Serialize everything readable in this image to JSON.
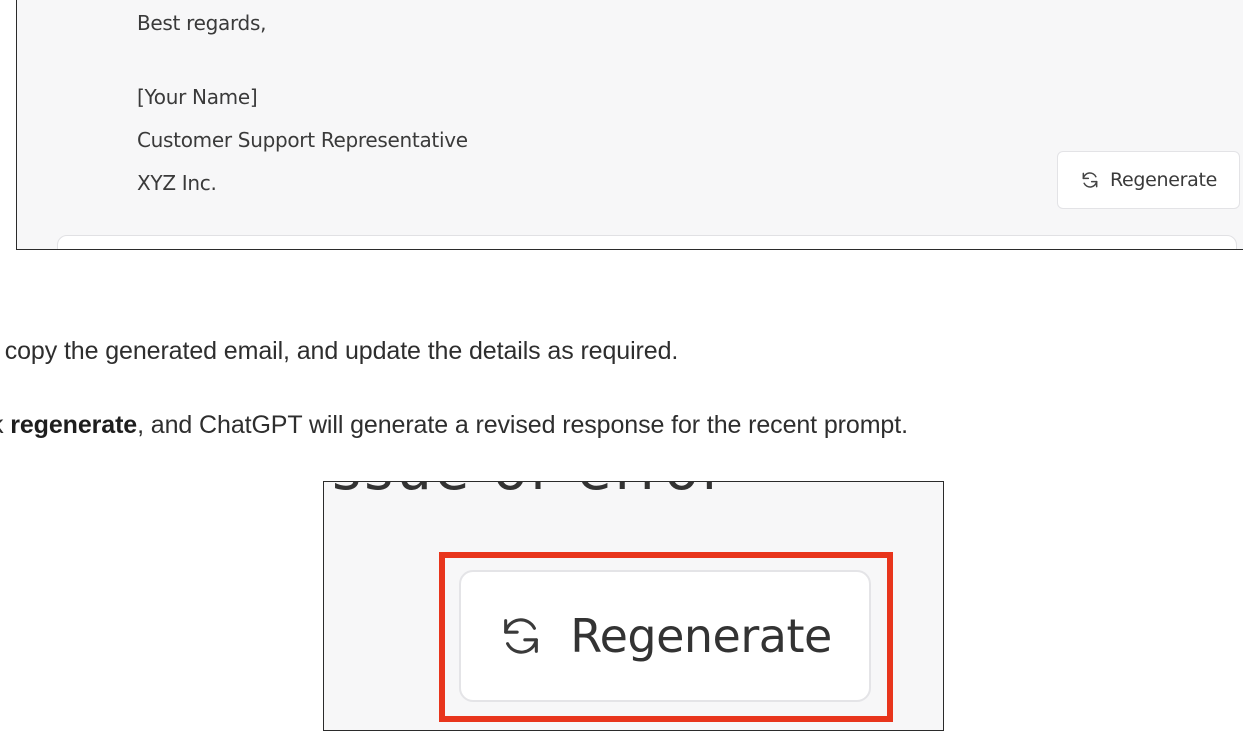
{
  "email": {
    "closing": "Best regards,",
    "name": "[Your Name]",
    "title": "Customer Support Representative",
    "company": "XYZ Inc.",
    "regenerate_label": "Regenerate",
    "regenerate_icon": "refresh-icon"
  },
  "instructions": {
    "line1": ", copy the generated email, and update the details as required.",
    "line2_prefix": "k ",
    "line2_bold": "regenerate",
    "line2_suffix": ", and ChatGPT will generate a revised response for the recent prompt."
  },
  "zoom": {
    "cut_text": "ssue or error",
    "regenerate_label": "Regenerate",
    "regenerate_icon": "refresh-icon",
    "highlight_color": "#e8351c"
  }
}
